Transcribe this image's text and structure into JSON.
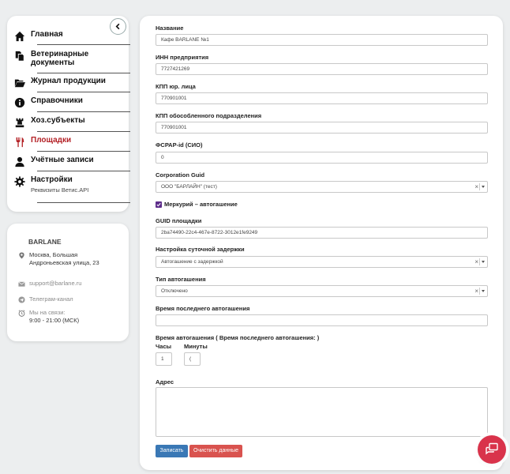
{
  "nav": {
    "items": [
      {
        "label": "Главная",
        "icon": "home-icon"
      },
      {
        "label": "Ветеринарные документы",
        "icon": "documents-icon"
      },
      {
        "label": "Журнал продукции",
        "icon": "folder-open-icon"
      },
      {
        "label": "Справочники",
        "icon": "info-icon"
      },
      {
        "label": "Хоз.субъекты",
        "icon": "chess-rook-icon"
      },
      {
        "label": "Площадки",
        "icon": "utensils-icon",
        "active": true
      },
      {
        "label": "Учётные записи",
        "icon": "user-icon"
      },
      {
        "label": "Настройки",
        "icon": "gear-icon",
        "sublabel": "Реквизиты Ветис.API"
      }
    ],
    "active_color": "#b32025"
  },
  "contacts": {
    "company": "BARLANE",
    "address": "Москва, Большая Андроньевская улица, 23",
    "email": "support@barlane.ru",
    "telegram": "Телеграм-канал",
    "hours_label": "Мы на связи:",
    "hours": "9:00 - 21:00 (МСК)"
  },
  "form": {
    "name": {
      "label": "Название",
      "value": "Кафе BARLANE №1"
    },
    "inn": {
      "label": "ИНН предприятия",
      "value": "7727421269"
    },
    "kpp": {
      "label": "КПП юр. лица",
      "value": "770901001"
    },
    "kpp_branch": {
      "label": "КПП обособленного подразделения",
      "value": "770901001"
    },
    "fsrar": {
      "label": "ФСРАР-id (СИО)",
      "value": "0"
    },
    "corp_guid": {
      "label": "Corporation Guid",
      "value": "ООО \"БАРЛАЙН\" (тест)"
    },
    "mercury_auto": {
      "label": "Меркурий – автогашение",
      "checked": true
    },
    "site_guid": {
      "label": "GUID площадки",
      "value": "2ba74490-22c4-467e-8722-3012e1fe9249"
    },
    "daily_delay": {
      "label": "Настройка суточной задержки",
      "value": "Автогашение с задержкой"
    },
    "auto_type": {
      "label": "Тип автогашения",
      "value": "Отключено"
    },
    "last_auto": {
      "label": "Время последнего автогашения",
      "value": ""
    },
    "auto_time": {
      "label": "Время автогашения ( Время последнего автогашения: )",
      "hours_label": "Часы",
      "minutes_label": "Минуты",
      "hours_value": "1",
      "minutes_value": "("
    },
    "address": {
      "label": "Адрес",
      "value": ""
    },
    "save_label": "Записать",
    "clear_label": "Очистить данные"
  },
  "colors": {
    "primary": "#3a78b5",
    "danger": "#d9534f",
    "fab": "#d9334b",
    "checkbox": "#5d2d8a"
  },
  "fab_icon": "chat-help-icon"
}
